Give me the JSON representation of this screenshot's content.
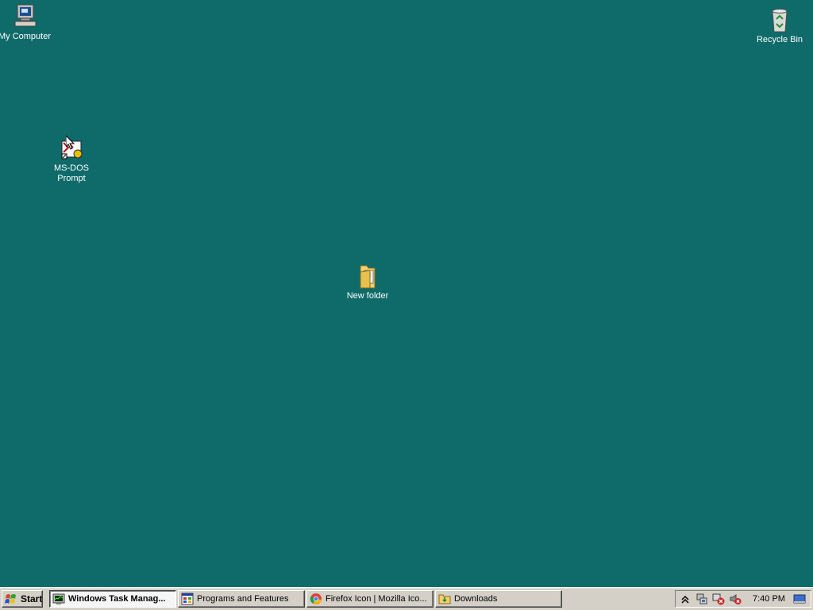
{
  "desktop": {
    "background_color": "#0f6a6a",
    "icons": {
      "my_computer": "My Computer",
      "recycle_bin": "Recycle Bin",
      "msdos_line1": "MS-DOS",
      "msdos_line2": "Prompt",
      "new_folder": "New folder"
    }
  },
  "taskbar": {
    "start_label": "Start",
    "tasks": [
      {
        "label": "Windows Task Manag...",
        "icon": "task-manager-icon",
        "active": true
      },
      {
        "label": "Programs and Features",
        "icon": "programs-features-icon",
        "active": false
      },
      {
        "label": "Firefox Icon | Mozilla Ico...",
        "icon": "chrome-icon",
        "active": false
      },
      {
        "label": "Downloads",
        "icon": "folder-icon",
        "active": false
      }
    ],
    "tray": {
      "icons": [
        "show-hidden-icon",
        "network-icon",
        "network-error-icon",
        "volume-muted-icon",
        "desktop-icon"
      ],
      "clock": "7:40 PM"
    }
  }
}
